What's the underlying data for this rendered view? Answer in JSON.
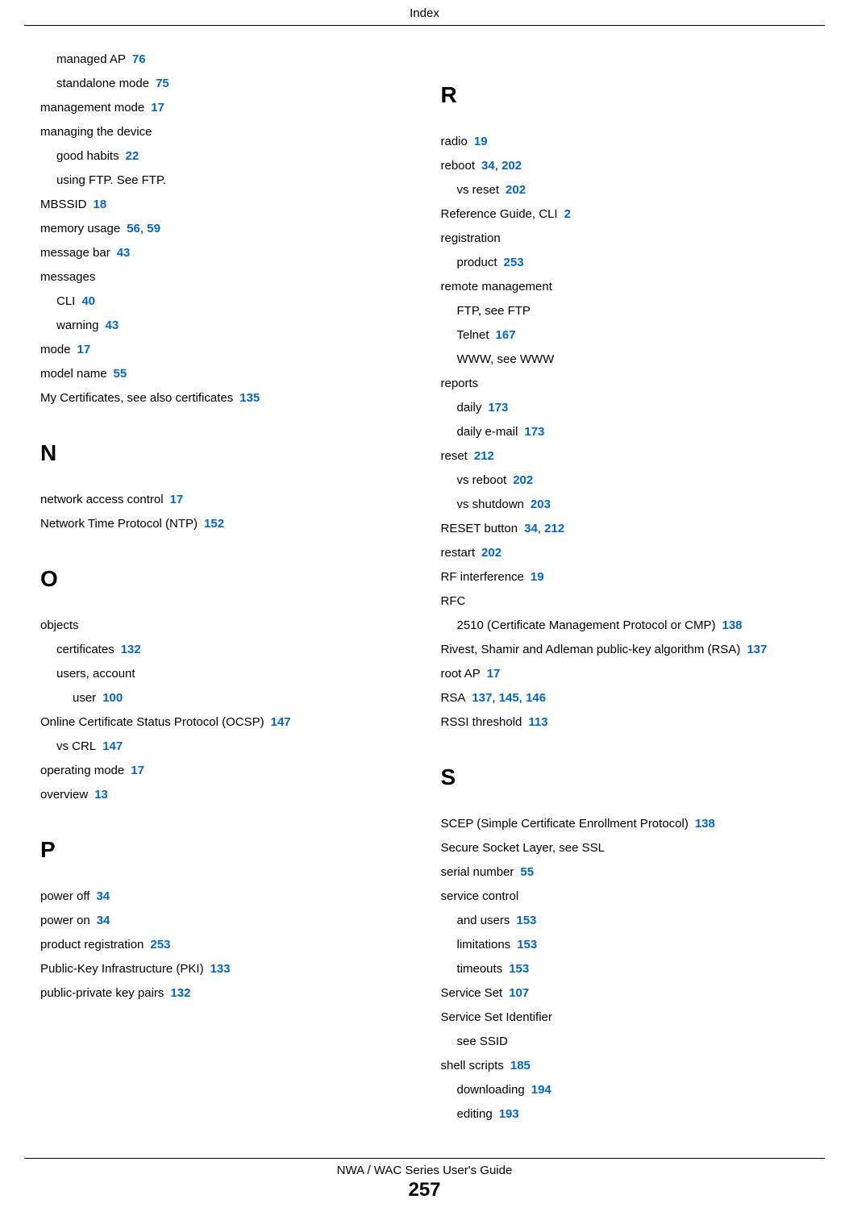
{
  "header": "Index",
  "footer": {
    "guide": "NWA / WAC Series User's Guide",
    "page": "257"
  },
  "left": {
    "groups": [
      {
        "letter": null,
        "items": [
          {
            "text": "managed AP",
            "pages": [
              "76"
            ],
            "level": 1
          },
          {
            "text": "standalone mode",
            "pages": [
              "75"
            ],
            "level": 1
          },
          {
            "text": "management mode",
            "pages": [
              "17"
            ],
            "level": 0
          },
          {
            "text": "managing the device",
            "pages": [],
            "level": 0
          },
          {
            "text": "good habits",
            "pages": [
              "22"
            ],
            "level": 1
          },
          {
            "text": "using FTP. See FTP.",
            "pages": [],
            "level": 1
          },
          {
            "text": "MBSSID",
            "pages": [
              "18"
            ],
            "level": 0
          },
          {
            "text": "memory usage",
            "pages": [
              "56",
              "59"
            ],
            "level": 0
          },
          {
            "text": "message bar",
            "pages": [
              "43"
            ],
            "level": 0
          },
          {
            "text": "messages",
            "pages": [],
            "level": 0
          },
          {
            "text": "CLI",
            "pages": [
              "40"
            ],
            "level": 1
          },
          {
            "text": "warning",
            "pages": [
              "43"
            ],
            "level": 1
          },
          {
            "text": "mode",
            "pages": [
              "17"
            ],
            "level": 0
          },
          {
            "text": "model name",
            "pages": [
              "55"
            ],
            "level": 0
          },
          {
            "text": "My Certificates, see also certificates",
            "pages": [
              "135"
            ],
            "level": 0
          }
        ]
      },
      {
        "letter": "N",
        "items": [
          {
            "text": "network access control",
            "pages": [
              "17"
            ],
            "level": 0
          },
          {
            "text": "Network Time Protocol (NTP)",
            "pages": [
              "152"
            ],
            "level": 0
          }
        ]
      },
      {
        "letter": "O",
        "items": [
          {
            "text": "objects",
            "pages": [],
            "level": 0
          },
          {
            "text": "certificates",
            "pages": [
              "132"
            ],
            "level": 1
          },
          {
            "text": "users, account",
            "pages": [],
            "level": 1
          },
          {
            "text": "user",
            "pages": [
              "100"
            ],
            "level": 2
          },
          {
            "text": "Online Certificate Status Protocol (OCSP)",
            "pages": [
              "147"
            ],
            "level": 0
          },
          {
            "text": "vs CRL",
            "pages": [
              "147"
            ],
            "level": 1
          },
          {
            "text": "operating mode",
            "pages": [
              "17"
            ],
            "level": 0
          },
          {
            "text": "overview",
            "pages": [
              "13"
            ],
            "level": 0
          }
        ]
      },
      {
        "letter": "P",
        "items": [
          {
            "text": "power off",
            "pages": [
              "34"
            ],
            "level": 0
          },
          {
            "text": "power on",
            "pages": [
              "34"
            ],
            "level": 0
          },
          {
            "text": "product registration",
            "pages": [
              "253"
            ],
            "level": 0
          },
          {
            "text": "Public-Key Infrastructure (PKI)",
            "pages": [
              "133"
            ],
            "level": 0
          },
          {
            "text": "public-private key pairs",
            "pages": [
              "132"
            ],
            "level": 0
          }
        ]
      }
    ]
  },
  "right": {
    "groups": [
      {
        "letter": "R",
        "items": [
          {
            "text": "radio",
            "pages": [
              "19"
            ],
            "level": 0
          },
          {
            "text": "reboot",
            "pages": [
              "34",
              "202"
            ],
            "level": 0
          },
          {
            "text": "vs reset",
            "pages": [
              "202"
            ],
            "level": 1
          },
          {
            "text": "Reference Guide, CLI",
            "pages": [
              "2"
            ],
            "level": 0
          },
          {
            "text": "registration",
            "pages": [],
            "level": 0
          },
          {
            "text": "product",
            "pages": [
              "253"
            ],
            "level": 1
          },
          {
            "text": "remote management",
            "pages": [],
            "level": 0
          },
          {
            "text": "FTP, see FTP",
            "pages": [],
            "level": 1
          },
          {
            "text": "Telnet",
            "pages": [
              "167"
            ],
            "level": 1
          },
          {
            "text": "WWW, see WWW",
            "pages": [],
            "level": 1
          },
          {
            "text": "reports",
            "pages": [],
            "level": 0
          },
          {
            "text": "daily",
            "pages": [
              "173"
            ],
            "level": 1
          },
          {
            "text": "daily e-mail",
            "pages": [
              "173"
            ],
            "level": 1
          },
          {
            "text": "reset",
            "pages": [
              "212"
            ],
            "level": 0
          },
          {
            "text": "vs reboot",
            "pages": [
              "202"
            ],
            "level": 1
          },
          {
            "text": "vs shutdown",
            "pages": [
              "203"
            ],
            "level": 1
          },
          {
            "text": "RESET button",
            "pages": [
              "34",
              "212"
            ],
            "level": 0
          },
          {
            "text": "restart",
            "pages": [
              "202"
            ],
            "level": 0
          },
          {
            "text": "RF interference",
            "pages": [
              "19"
            ],
            "level": 0
          },
          {
            "text": "RFC",
            "pages": [],
            "level": 0
          },
          {
            "text": "2510 (Certificate Management Protocol or CMP)",
            "pages": [
              "138"
            ],
            "level": 1,
            "wrap": true
          },
          {
            "text": "Rivest, Shamir and Adleman public-key algorithm (RSA)",
            "pages": [
              "137"
            ],
            "level": 0,
            "wrap": true
          },
          {
            "text": "root AP",
            "pages": [
              "17"
            ],
            "level": 0
          },
          {
            "text": "RSA",
            "pages": [
              "137",
              "145",
              "146"
            ],
            "level": 0
          },
          {
            "text": "RSSI threshold",
            "pages": [
              "113"
            ],
            "level": 0
          }
        ]
      },
      {
        "letter": "S",
        "items": [
          {
            "text": "SCEP (Simple Certificate Enrollment Protocol)",
            "pages": [
              "138"
            ],
            "level": 0
          },
          {
            "text": "Secure Socket Layer, see SSL",
            "pages": [],
            "level": 0
          },
          {
            "text": "serial number",
            "pages": [
              "55"
            ],
            "level": 0
          },
          {
            "text": "service control",
            "pages": [],
            "level": 0
          },
          {
            "text": "and users",
            "pages": [
              "153"
            ],
            "level": 1
          },
          {
            "text": "limitations",
            "pages": [
              "153"
            ],
            "level": 1
          },
          {
            "text": "timeouts",
            "pages": [
              "153"
            ],
            "level": 1
          },
          {
            "text": "Service Set",
            "pages": [
              "107"
            ],
            "level": 0
          },
          {
            "text": "Service Set Identifier",
            "pages": [],
            "level": 0
          },
          {
            "text": "see SSID",
            "pages": [],
            "level": 1
          },
          {
            "text": "shell scripts",
            "pages": [
              "185"
            ],
            "level": 0
          },
          {
            "text": "downloading",
            "pages": [
              "194"
            ],
            "level": 1
          },
          {
            "text": "editing",
            "pages": [
              "193"
            ],
            "level": 1
          }
        ]
      }
    ]
  }
}
